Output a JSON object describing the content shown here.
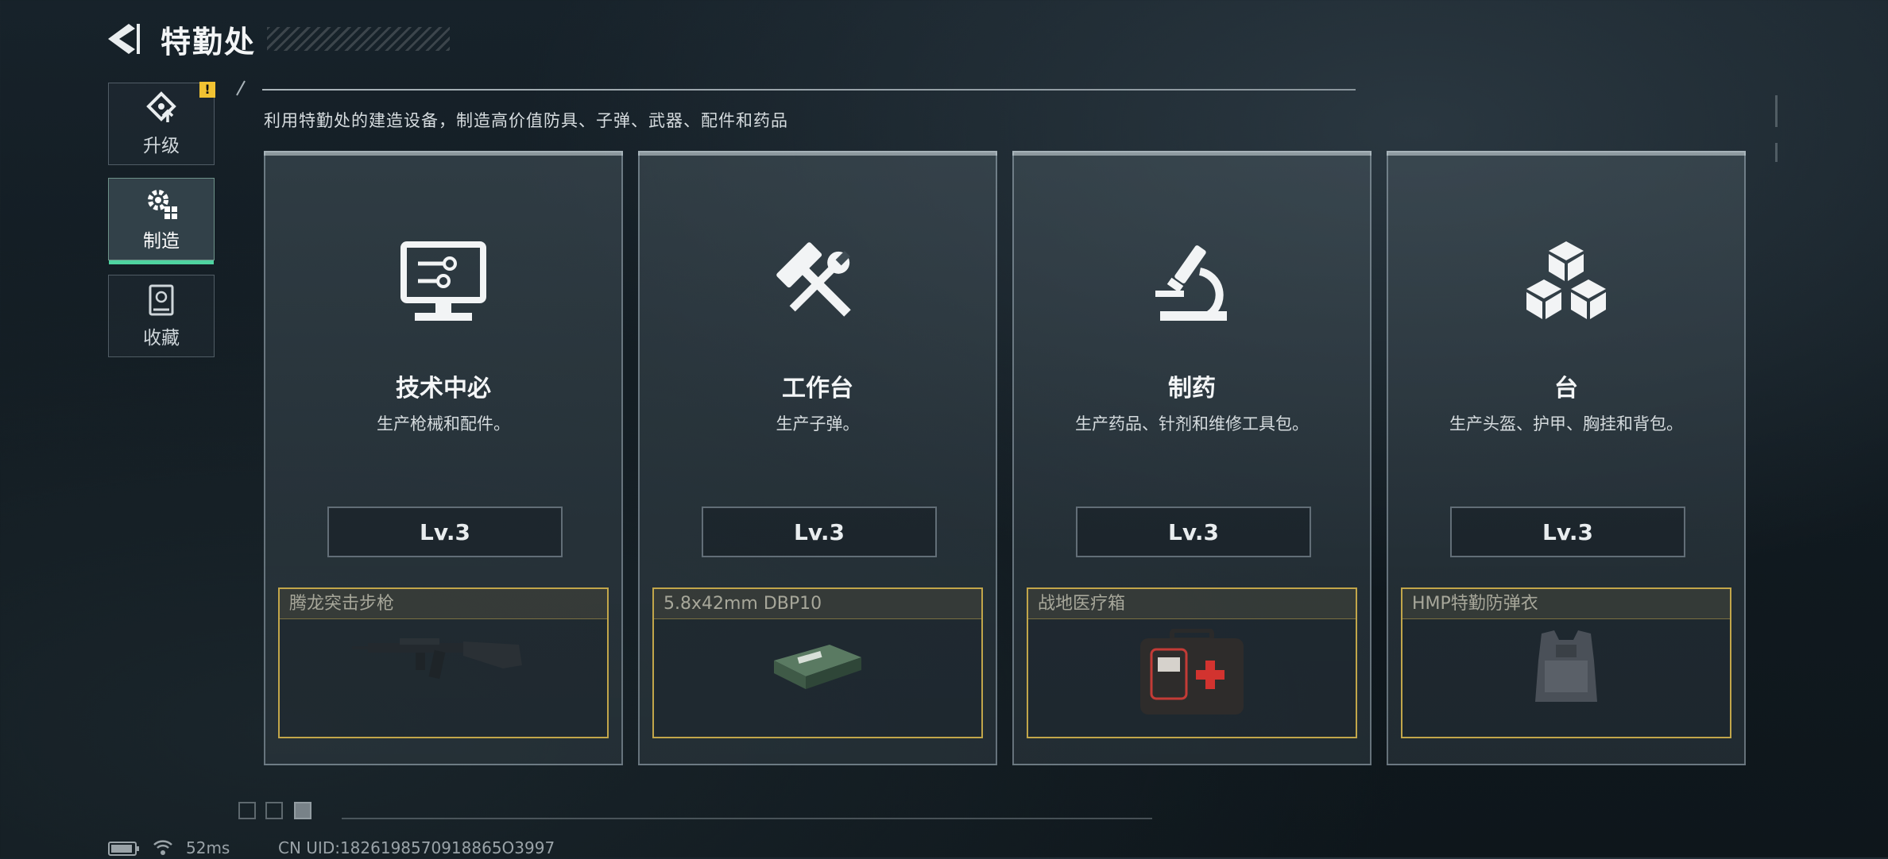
{
  "header": {
    "title": "特勤处"
  },
  "sidebar": {
    "items": [
      {
        "label": "升级",
        "icon": "upgrade-icon",
        "badge": "!"
      },
      {
        "label": "制造",
        "icon": "gear-craft-icon",
        "selected": true
      },
      {
        "label": "收藏",
        "icon": "collection-icon"
      }
    ]
  },
  "description": "利用特勤处的建造设备，制造高价值防具、子弹、武器、配件和药品",
  "cards": [
    {
      "title": "技术中必",
      "desc": "生产枪械和配件。",
      "level": "Lv.3",
      "icon": "computer-icon",
      "item": "腾龙突击步枪"
    },
    {
      "title": "工作台",
      "desc": "生产子弹。",
      "level": "Lv.3",
      "icon": "hammer-wrench-icon",
      "item": "5.8x42mm DBP10"
    },
    {
      "title": "制药",
      "desc": "生产药品、针剂和维修工具包。",
      "level": "Lv.3",
      "icon": "microscope-icon",
      "item": "战地医疗箱"
    },
    {
      "title": "台",
      "desc": "生产头盔、护甲、胸挂和背包。",
      "level": "Lv.3",
      "icon": "cubes-icon",
      "item": "HMP特勤防弹衣"
    }
  ],
  "status": {
    "ping": "52ms",
    "uid": "CN UID:1826198570918865O3997"
  },
  "colors": {
    "accent_green": "#4fd3a0",
    "item_border_gold": "#c2a64a",
    "warning_yellow": "#f1c232"
  }
}
